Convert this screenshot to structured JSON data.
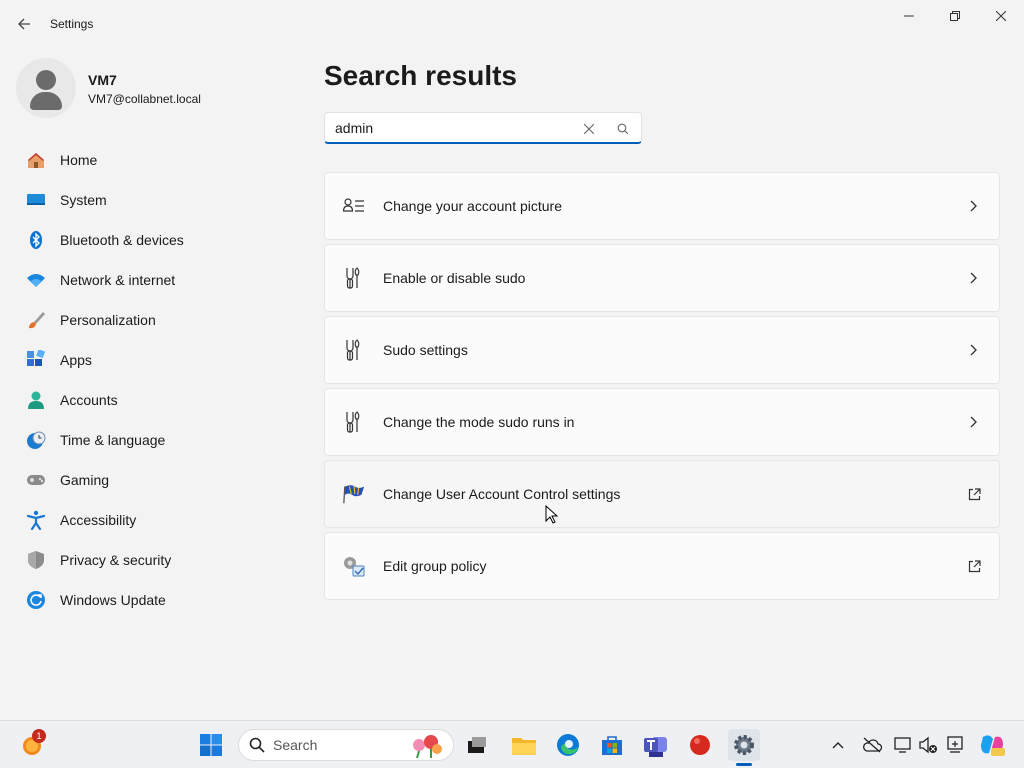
{
  "window": {
    "title": "Settings",
    "controls": {
      "minimize": "minimize-icon",
      "maximize": "restore-icon",
      "close": "close-icon"
    }
  },
  "profile": {
    "name": "VM7",
    "email": "VM7@collabnet.local"
  },
  "sidebar": {
    "items": [
      {
        "label": "Home",
        "icon": "home-icon"
      },
      {
        "label": "System",
        "icon": "system-icon"
      },
      {
        "label": "Bluetooth & devices",
        "icon": "bluetooth-icon"
      },
      {
        "label": "Network & internet",
        "icon": "wifi-icon"
      },
      {
        "label": "Personalization",
        "icon": "brush-icon"
      },
      {
        "label": "Apps",
        "icon": "apps-icon"
      },
      {
        "label": "Accounts",
        "icon": "accounts-icon"
      },
      {
        "label": "Time & language",
        "icon": "clock-globe-icon"
      },
      {
        "label": "Gaming",
        "icon": "gamepad-icon"
      },
      {
        "label": "Accessibility",
        "icon": "accessibility-icon"
      },
      {
        "label": "Privacy & security",
        "icon": "shield-icon"
      },
      {
        "label": "Windows Update",
        "icon": "update-icon"
      }
    ]
  },
  "main": {
    "title": "Search results",
    "search": {
      "value": "admin",
      "placeholder": ""
    },
    "results": [
      {
        "label": "Change your account picture",
        "icon": "account-picture-icon",
        "action": "chevron-right-icon"
      },
      {
        "label": "Enable or disable sudo",
        "icon": "sudo-icon",
        "action": "chevron-right-icon"
      },
      {
        "label": "Sudo settings",
        "icon": "sudo-icon",
        "action": "chevron-right-icon"
      },
      {
        "label": "Change the mode sudo runs in",
        "icon": "sudo-icon",
        "action": "chevron-right-icon"
      },
      {
        "label": "Change User Account Control settings",
        "icon": "uac-flag-icon",
        "action": "open-external-icon"
      },
      {
        "label": "Edit group policy",
        "icon": "group-policy-icon",
        "action": "open-external-icon"
      }
    ]
  },
  "taskbar": {
    "search_label": "Search",
    "notification_badge": "1",
    "accent": "#005fb8"
  }
}
